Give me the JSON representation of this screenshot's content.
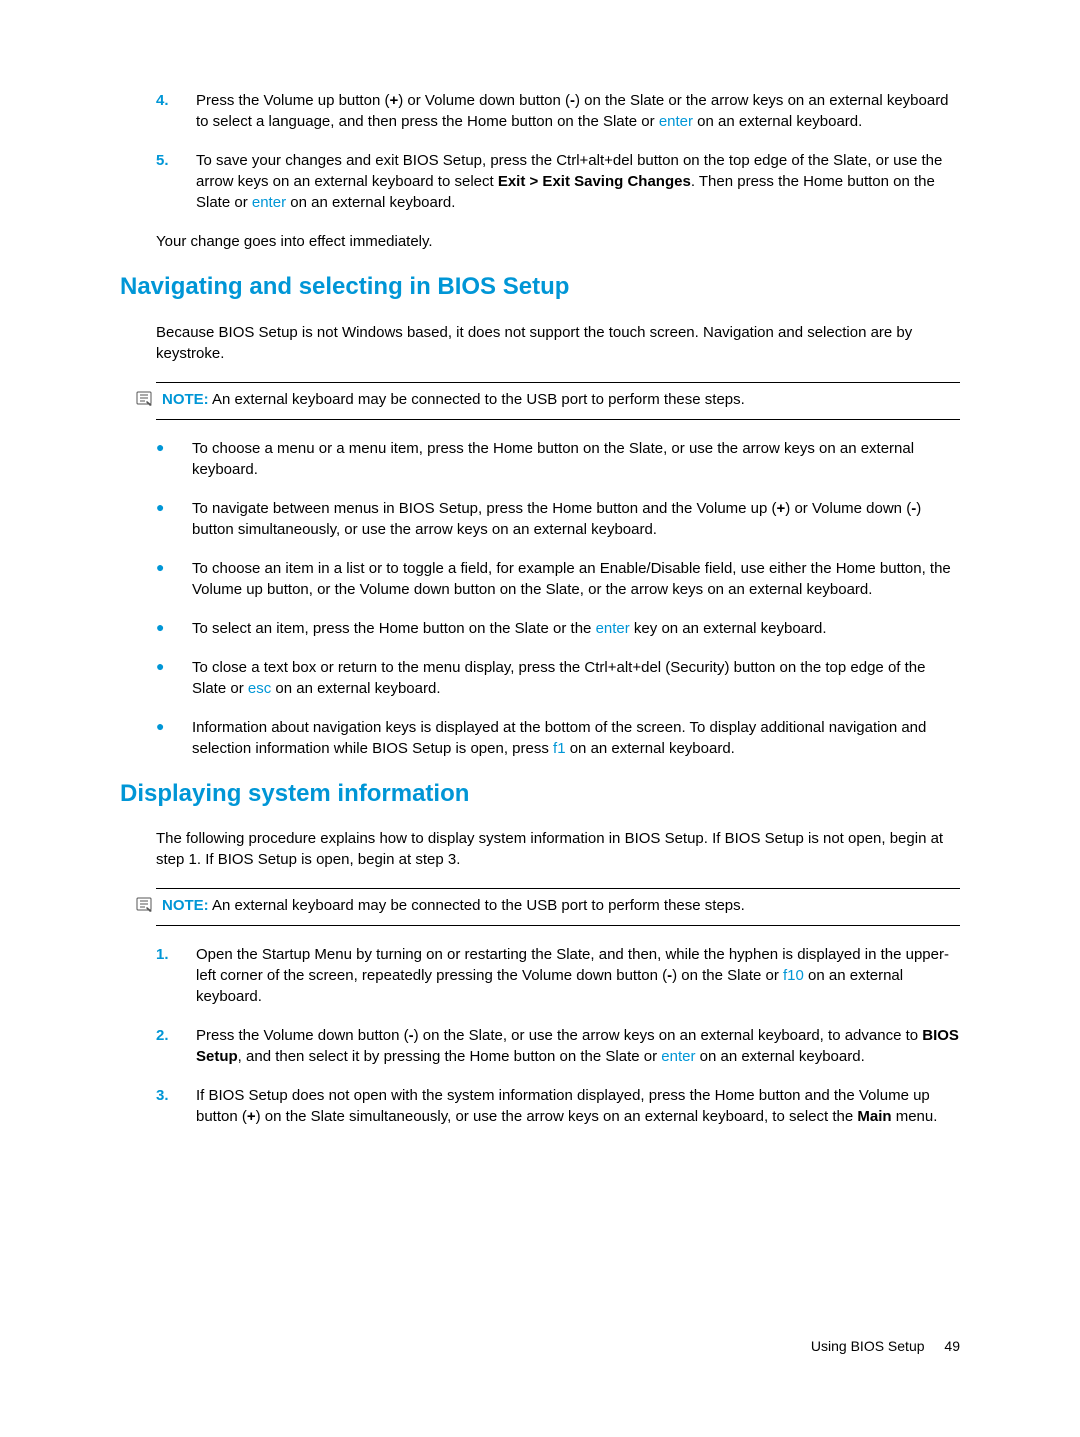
{
  "ol_top": {
    "items": [
      {
        "num": "4.",
        "pre": "Press the Volume up button (",
        "b1": "+",
        "mid1": ") or Volume down button (",
        "b2": "-",
        "mid2": ") on the Slate or the arrow keys on an external keyboard to select a language, and then press the Home button on the Slate or ",
        "key1": "enter",
        "tail": " on an external keyboard."
      },
      {
        "num": "5.",
        "pre": "To save your changes and exit BIOS Setup, press the Ctrl+alt+del button on the top edge of the Slate, or use the arrow keys on an external keyboard to select ",
        "b1": "Exit > Exit Saving Changes",
        "mid1": ". Then press the Home button on the Slate or ",
        "key1": "enter",
        "tail": " on an external keyboard."
      }
    ]
  },
  "para_after_ol_top": "Your change goes into effect immediately.",
  "section1": {
    "heading": "Navigating and selecting in BIOS Setup",
    "intro": "Because BIOS Setup is not Windows based, it does not support the touch screen. Navigation and selection are by keystroke.",
    "note_label": "NOTE:",
    "note_text": "An external keyboard may be connected to the USB port to perform these steps.",
    "bullets": [
      {
        "pre": "To choose a menu or a menu item, press the Home button on the Slate, or use the arrow keys on an external keyboard."
      },
      {
        "pre": "To navigate between menus in BIOS Setup, press the Home button and the Volume up (",
        "b1": "+",
        "mid1": ") or Volume down (",
        "b2": "-",
        "mid2": ") button simultaneously, or use the arrow keys on an external keyboard."
      },
      {
        "pre": "To choose an item in a list or to toggle a field, for example an Enable/Disable field, use either the Home button, the Volume up button, or the Volume down button on the Slate, or the arrow keys on an external keyboard."
      },
      {
        "pre": "To select an item, press the Home button on the Slate or the ",
        "key1": "enter",
        "tail": " key on an external keyboard."
      },
      {
        "pre": "To close a text box or return to the menu display, press the Ctrl+alt+del (Security) button on the top edge of the Slate or ",
        "key1": "esc",
        "tail": " on an external keyboard."
      },
      {
        "pre": "Information about navigation keys is displayed at the bottom of the screen. To display additional navigation and selection information while BIOS Setup is open, press ",
        "key1": "f1",
        "tail": " on an external keyboard."
      }
    ]
  },
  "section2": {
    "heading": "Displaying system information",
    "intro": "The following procedure explains how to display system information in BIOS Setup. If BIOS Setup is not open, begin at step 1. If BIOS Setup is open, begin at step 3.",
    "note_label": "NOTE:",
    "note_text": "An external keyboard may be connected to the USB port to perform these steps.",
    "steps": [
      {
        "num": "1.",
        "pre": "Open the Startup Menu by turning on or restarting the Slate, and then, while the hyphen is displayed in the upper-left corner of the screen, repeatedly pressing the Volume down button (",
        "b1": "-",
        "mid1": ") on the Slate or ",
        "key1": "f10",
        "tail": " on an external keyboard."
      },
      {
        "num": "2.",
        "pre": "Press the Volume down button (",
        "b1": "-",
        "mid1": ") on the Slate, or use the arrow keys on an external keyboard, to advance to ",
        "b2": "BIOS Setup",
        "mid2": ", and then select it by pressing the Home button on the Slate or ",
        "key1": "enter",
        "tail": " on an external keyboard."
      },
      {
        "num": "3.",
        "pre": "If BIOS Setup does not open with the system information displayed, press the Home button and the Volume up button (",
        "b1": "+",
        "mid1": ") on the Slate simultaneously, or use the arrow keys on an external keyboard, to select the ",
        "b2": "Main",
        "tail": " menu."
      }
    ]
  },
  "footer": {
    "text": "Using BIOS Setup",
    "page": "49"
  }
}
